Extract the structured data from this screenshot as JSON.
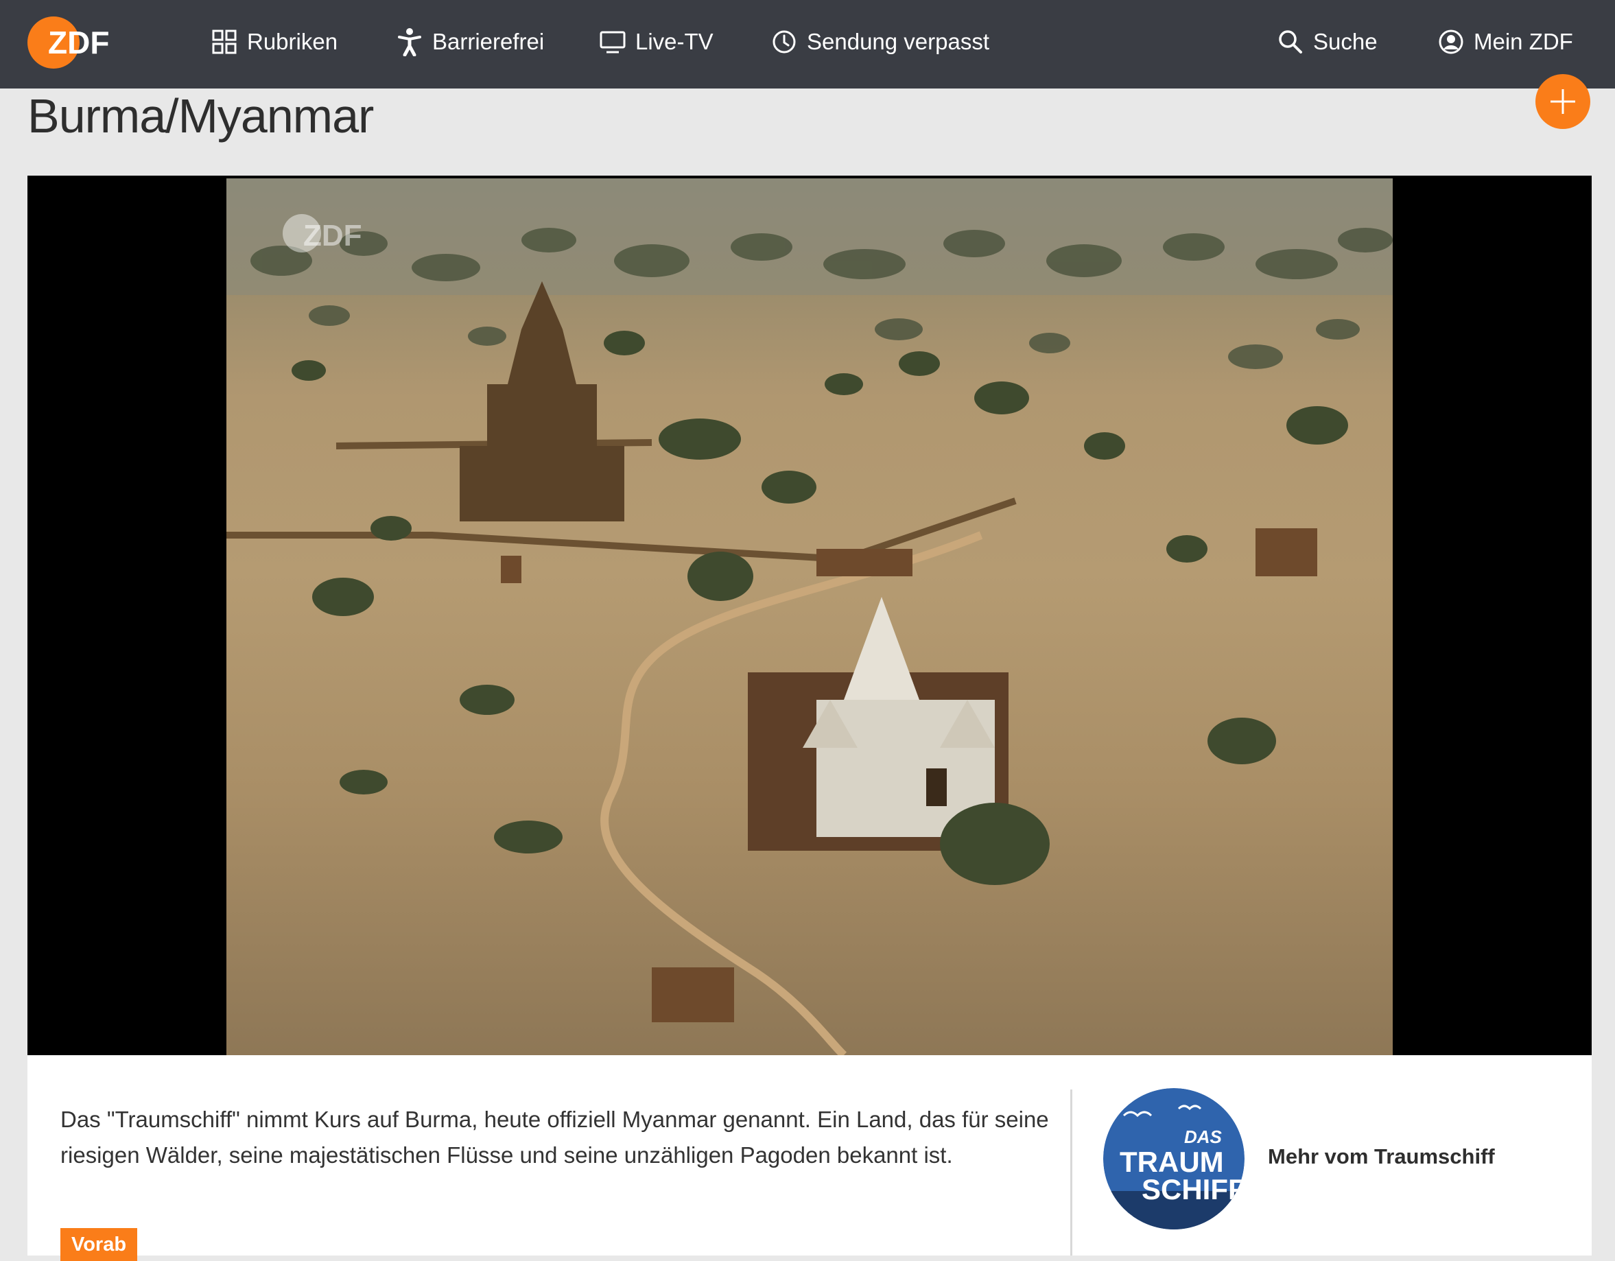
{
  "header": {
    "logo_text": "ZDF",
    "nav": [
      {
        "label": "Rubriken",
        "icon": "grid-icon"
      },
      {
        "label": "Barrierefrei",
        "icon": "accessibility-icon"
      },
      {
        "label": "Live-TV",
        "icon": "tv-icon"
      },
      {
        "label": "Sendung verpasst",
        "icon": "clock-icon"
      }
    ],
    "search_label": "Suche",
    "account_label": "Mein ZDF"
  },
  "page": {
    "title": "Burma/Myanmar",
    "add_icon": "plus-icon"
  },
  "player": {
    "watermark": "ZDF"
  },
  "info": {
    "description": "Das \"Traumschiff\" nimmt Kurs auf Burma, heute offiziell Myanmar genannt. Ein Land, das für seine riesigen Wälder, seine majestätischen Flüsse und seine unzähligen Pagoden bekannt ist.",
    "badge": "Vorab",
    "show_logo_lines": [
      "DAS",
      "TRAUM",
      "SCHIFF"
    ],
    "show_link": "Mehr vom Traumschiff"
  },
  "colors": {
    "accent": "#fa7d19",
    "header_bg": "#3a3d44",
    "page_bg": "#e8e8e8"
  }
}
